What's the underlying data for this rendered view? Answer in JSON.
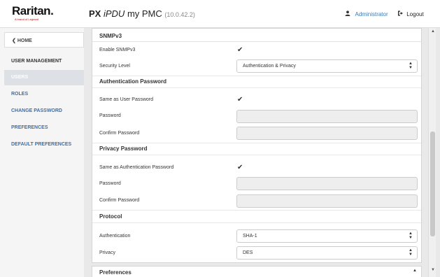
{
  "header": {
    "logo_text": "Raritan.",
    "logo_tagline": "A brand of Legrand",
    "device_prefix": "PX",
    "device_model": "iPDU",
    "device_name": "my PMC",
    "device_ip": "(10.0.42.2)",
    "user_label": "Administrator",
    "user_icon": "user-icon",
    "logout_label": "Logout",
    "logout_icon": "logout-icon"
  },
  "sidebar": {
    "home_label": "HOME",
    "section_label": "USER MANAGEMENT",
    "items": [
      {
        "label": "USERS",
        "active": true
      },
      {
        "label": "ROLES",
        "active": false
      },
      {
        "label": "CHANGE PASSWORD",
        "active": false
      },
      {
        "label": "PREFERENCES",
        "active": false
      },
      {
        "label": "DEFAULT PREFERENCES",
        "active": false
      }
    ]
  },
  "panel": {
    "title": "SNMPv3",
    "enable_label": "Enable SNMPv3",
    "enable_checked": true,
    "security_level_label": "Security Level",
    "security_level_value": "Authentication & Privacy",
    "auth_section": "Authentication Password",
    "auth_same_label": "Same as User Password",
    "auth_same_checked": true,
    "auth_password_label": "Password",
    "auth_confirm_label": "Confirm Password",
    "priv_section": "Privacy Password",
    "priv_same_label": "Same as Authentication Password",
    "priv_same_checked": true,
    "priv_password_label": "Password",
    "priv_confirm_label": "Confirm Password",
    "protocol_section": "Protocol",
    "authentication_label": "Authentication",
    "authentication_value": "SHA-1",
    "privacy_label": "Privacy",
    "privacy_value": "DES"
  },
  "bottom_panel": {
    "title": "Preferences"
  },
  "glyphs": {
    "check": "✔",
    "chevron_left": "❮",
    "select_arrows_up": "▲",
    "select_arrows_down": "▼"
  },
  "colors": {
    "link": "#3a6fb0",
    "active_item_bg": "#dde0e4"
  }
}
